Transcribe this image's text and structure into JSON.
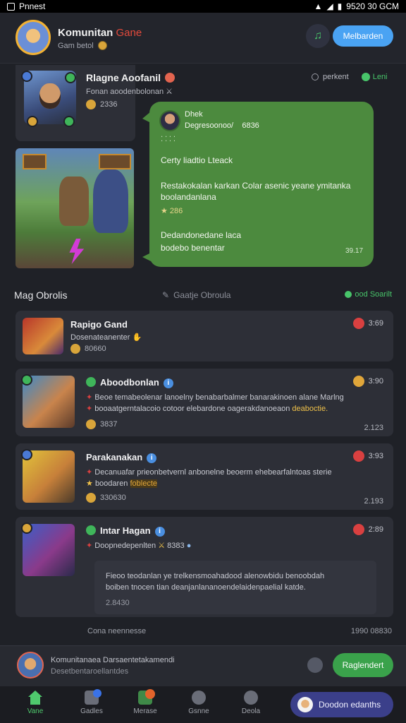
{
  "statusbar": {
    "app": "Pnnest",
    "time": "9520 30 GCM"
  },
  "header": {
    "title": "Komunitan",
    "title_accent": "Gane",
    "subtitle": "Gam betol",
    "bell_icon": "bell-icon",
    "join_label": "Melbarden"
  },
  "featured": {
    "name": "Rlagne Aoofanil",
    "sub": "Fonan aoodenbolonan",
    "points": "2336",
    "online_label": "perkent",
    "live_label": "Leni"
  },
  "bubble": {
    "name": "Dhek",
    "line1": "Degresoonoo/    6836",
    "line2": "Certy liadtio Lteack",
    "line3": "Restakokalan karkan Colar asenic yeane ymitanka",
    "line4": "boolandanlana",
    "line5": "286",
    "line6": "Dedandonedane laca",
    "line7": "bodebo benentar",
    "time": "39.17"
  },
  "section": {
    "title": "Mag Obrolis",
    "mid": "Gaatje Obroula",
    "right": "ood Soarilt"
  },
  "chats": [
    {
      "name": "Rapigo Gand",
      "line1": "Dosenateanenter",
      "meta": "80660",
      "time": "3:69"
    },
    {
      "name": "Aboodbonlan",
      "line1": "Beoe temabeolenar lanoelny benabarbalmer banarakinoen alane Marlng",
      "line2a": "booaatgerntalacoio cotoor elebardone oagerakdanoeaon",
      "line2b": "deaboctie.",
      "meta": "3837",
      "time": "3:90",
      "date": "2.123"
    },
    {
      "name": "Parakanakan",
      "line1": "Decanuafar prieonbetvernl anbonelne beoerm ehebearfalntoas sterie",
      "line2a": "boodaren",
      "line2b": "foblecte",
      "meta": "330630",
      "time": "3:93",
      "date": "2.193"
    },
    {
      "name": "Intar Hagan",
      "line1": "Doopnedepenlten",
      "line1b": "8383",
      "body1": "Fieoo teodanlan ye trelkensmoahadood alenowbidu benoobdah",
      "body2": "boiben tnocen tian deanjanlananoendelaidenpaelial katde.",
      "meta": "2.8430",
      "time": "2:89"
    }
  ],
  "footer_note": {
    "left": "Cona neennesse",
    "right": "1990 08830"
  },
  "composer": {
    "line1": "Komunitanaea Darsaentetakamendi",
    "line2": "Desetbentaroellantdes",
    "send_label": "Raglendert"
  },
  "nav": [
    {
      "label": "Vane",
      "icon": "home-icon"
    },
    {
      "label": "Gadles",
      "icon": "store-icon"
    },
    {
      "label": "Merase",
      "icon": "message-icon"
    },
    {
      "label": "Gsnne",
      "icon": "profile-icon"
    },
    {
      "label": "Deola",
      "icon": "compass-icon"
    }
  ],
  "support_label": "Doodon edanths",
  "colors": {
    "accent_green": "#3aa24b",
    "accent_blue": "#4aa3f3",
    "bubble_green": "#4c8a3e",
    "background": "#1f2127",
    "card": "#2d2f37"
  }
}
